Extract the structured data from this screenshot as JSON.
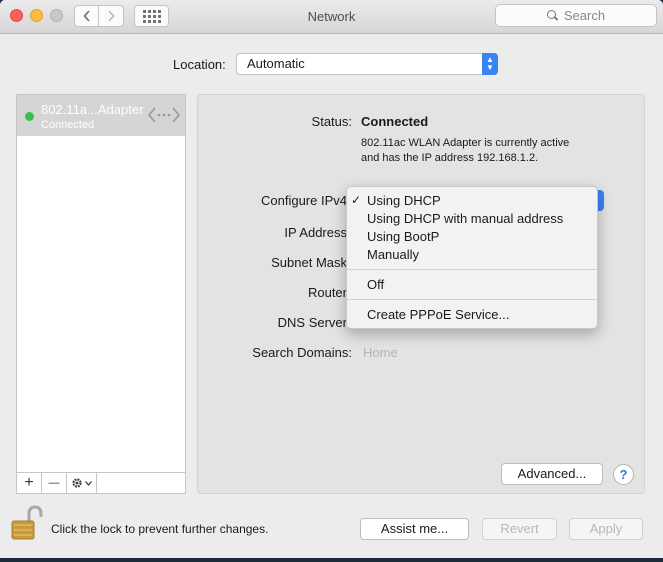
{
  "window": {
    "title": "Network"
  },
  "toolbar": {
    "search_placeholder": "Search"
  },
  "location": {
    "label": "Location:",
    "value": "Automatic"
  },
  "sidebar": {
    "services": [
      {
        "name": "802.11a...Adapter",
        "status": "Connected",
        "status_color": "#34c24a"
      }
    ],
    "add_label": "+",
    "remove_label": "—"
  },
  "details": {
    "status_label": "Status:",
    "status_value": "Connected",
    "status_desc_line1": "802.11ac WLAN Adapter  is currently active",
    "status_desc_line2": "and has the IP address 192.168.1.2.",
    "configure_label": "Configure IPv4",
    "ip_label": "IP Address",
    "subnet_label": "Subnet Mask",
    "router_label": "Router",
    "dns_label": "DNS Server",
    "search_domains_label": "Search Domains:",
    "search_domains_placeholder": "Home"
  },
  "configure_menu": {
    "selected": "Using DHCP",
    "items": [
      "Using DHCP",
      "Using DHCP with manual address",
      "Using BootP",
      "Manually",
      "Off",
      "Create PPPoE Service..."
    ]
  },
  "buttons": {
    "advanced": "Advanced...",
    "help": "?",
    "assist": "Assist me...",
    "revert": "Revert",
    "apply": "Apply"
  },
  "lock_text": "Click the lock to prevent further changes.",
  "colors": {
    "accent": "#3a83f5",
    "connected": "#34c24a"
  }
}
